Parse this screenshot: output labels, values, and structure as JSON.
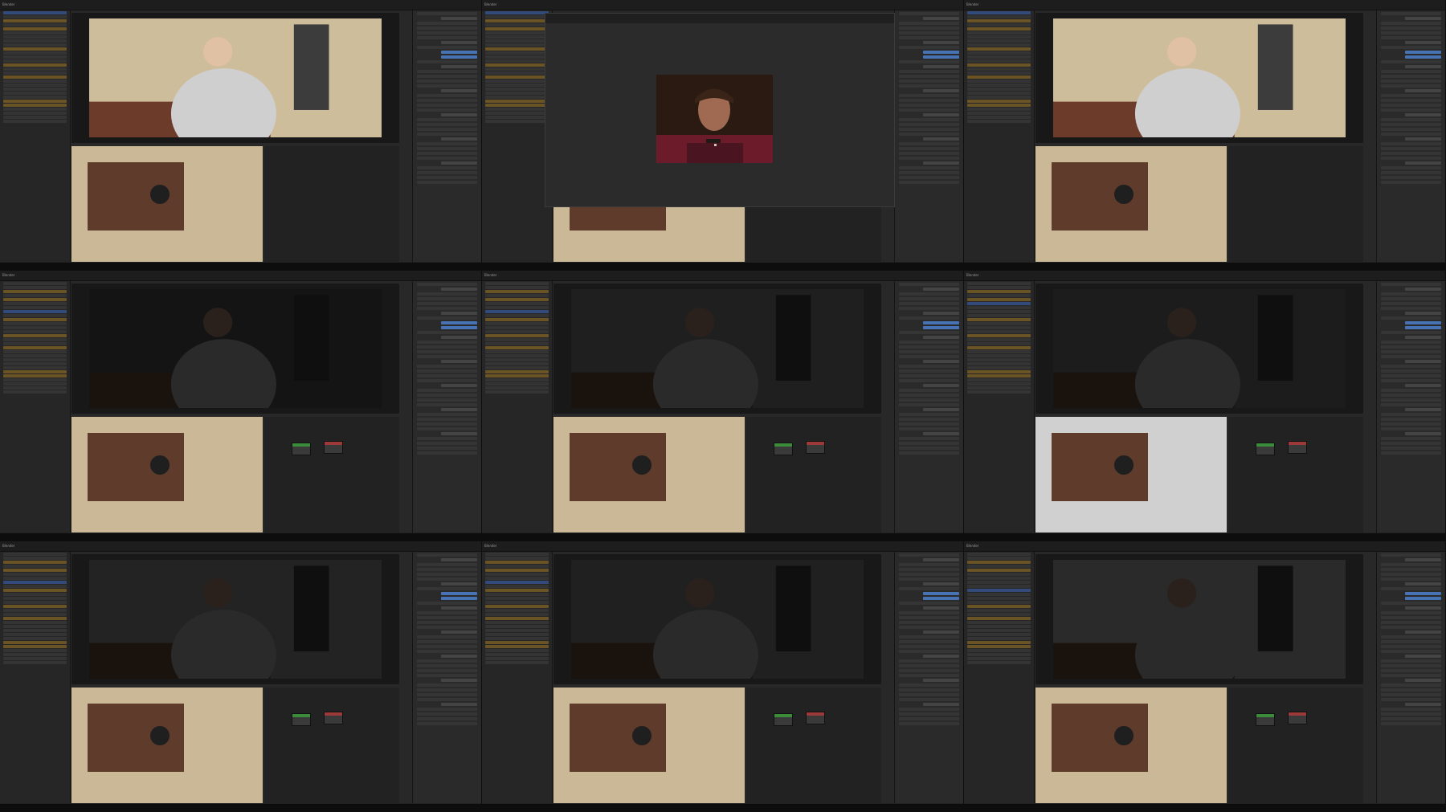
{
  "app": {
    "title": "Blender"
  },
  "tiles": [
    {
      "id": "t1",
      "render": "bright-office",
      "tone": "#cdbd9b",
      "outliner_selected": 0
    },
    {
      "id": "t2",
      "render": "portrait-window",
      "tone": "#2b2b2b",
      "outliner_selected": 0
    },
    {
      "id": "t3",
      "render": "bright-office",
      "tone": "#cdbd9b",
      "outliner_selected": 0
    },
    {
      "id": "t4",
      "render": "dark-window",
      "tone": "#141414",
      "outliner_selected": 7
    },
    {
      "id": "t5",
      "render": "dark-moody",
      "tone": "#1f1f1f",
      "outliner_selected": 7
    },
    {
      "id": "t6",
      "render": "dark-moody-light",
      "tone": "#1c1c1c",
      "outliner_selected": 5
    },
    {
      "id": "t7",
      "render": "dark-moody",
      "tone": "#232323",
      "outliner_selected": 7
    },
    {
      "id": "t8",
      "render": "dark-moody",
      "tone": "#202020",
      "outliner_selected": 7
    },
    {
      "id": "t9",
      "render": "dark-window",
      "tone": "#2a2a2a",
      "outliner_selected": 9
    }
  ],
  "colors": {
    "ui_bg": "#282828",
    "header_bg": "#1d1d1d",
    "accent_blue": "#4772b3",
    "outliner_orange": "#6a5324",
    "node_green": "#3a8b3a",
    "node_red": "#9c3a3a"
  }
}
